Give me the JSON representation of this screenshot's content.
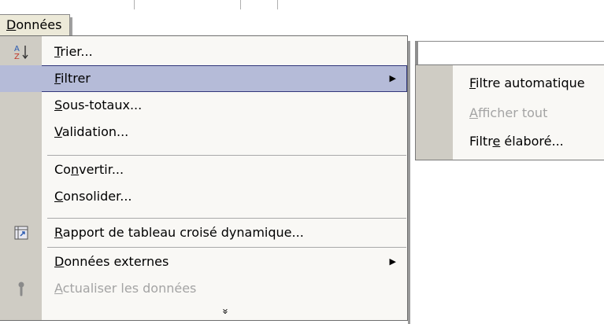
{
  "menubar": {
    "title": "Données",
    "mnemonic": "D",
    "rest": "onnées"
  },
  "menu": {
    "items": [
      {
        "icon": "sort-az-icon",
        "pre": "",
        "m": "T",
        "post": "rier...",
        "disabled": false,
        "submenu": false
      },
      {
        "icon": "",
        "pre": "",
        "m": "F",
        "post": "iltrer",
        "disabled": false,
        "submenu": true,
        "highlight": true
      },
      {
        "icon": "",
        "pre": "",
        "m": "S",
        "post": "ous-totaux...",
        "disabled": false,
        "submenu": false
      },
      {
        "icon": "",
        "pre": "",
        "m": "V",
        "post": "alidation...",
        "disabled": false,
        "submenu": false
      },
      {
        "icon": "",
        "pre": "Co",
        "m": "n",
        "post": "vertir...",
        "disabled": false,
        "submenu": false
      },
      {
        "icon": "",
        "pre": "",
        "m": "C",
        "post": "onsolider...",
        "disabled": false,
        "submenu": false
      },
      {
        "icon": "pivot-table-icon",
        "pre": "",
        "m": "R",
        "post": "apport de tableau croisé dynamique...",
        "disabled": false,
        "submenu": false
      },
      {
        "icon": "",
        "pre": "",
        "m": "D",
        "post": "onnées externes",
        "disabled": false,
        "submenu": true
      },
      {
        "icon": "refresh-icon",
        "pre": "",
        "m": "A",
        "post": "ctualiser les données",
        "disabled": true,
        "submenu": false
      }
    ],
    "more_glyph": "»"
  },
  "submenu": {
    "items": [
      {
        "pre": "",
        "m": "F",
        "post": "iltre automatique",
        "disabled": false
      },
      {
        "pre": "",
        "m": "A",
        "post": "fficher tout",
        "disabled": true
      },
      {
        "pre": "Filtr",
        "m": "e",
        "post": " élaboré...",
        "disabled": false
      }
    ]
  },
  "colors": {
    "highlight": "#b5bbd8",
    "highlight_border": "#31367a",
    "gutter": "#cfccc4",
    "menu_bg": "#f9f8f5",
    "disabled": "#a4a4a4"
  }
}
